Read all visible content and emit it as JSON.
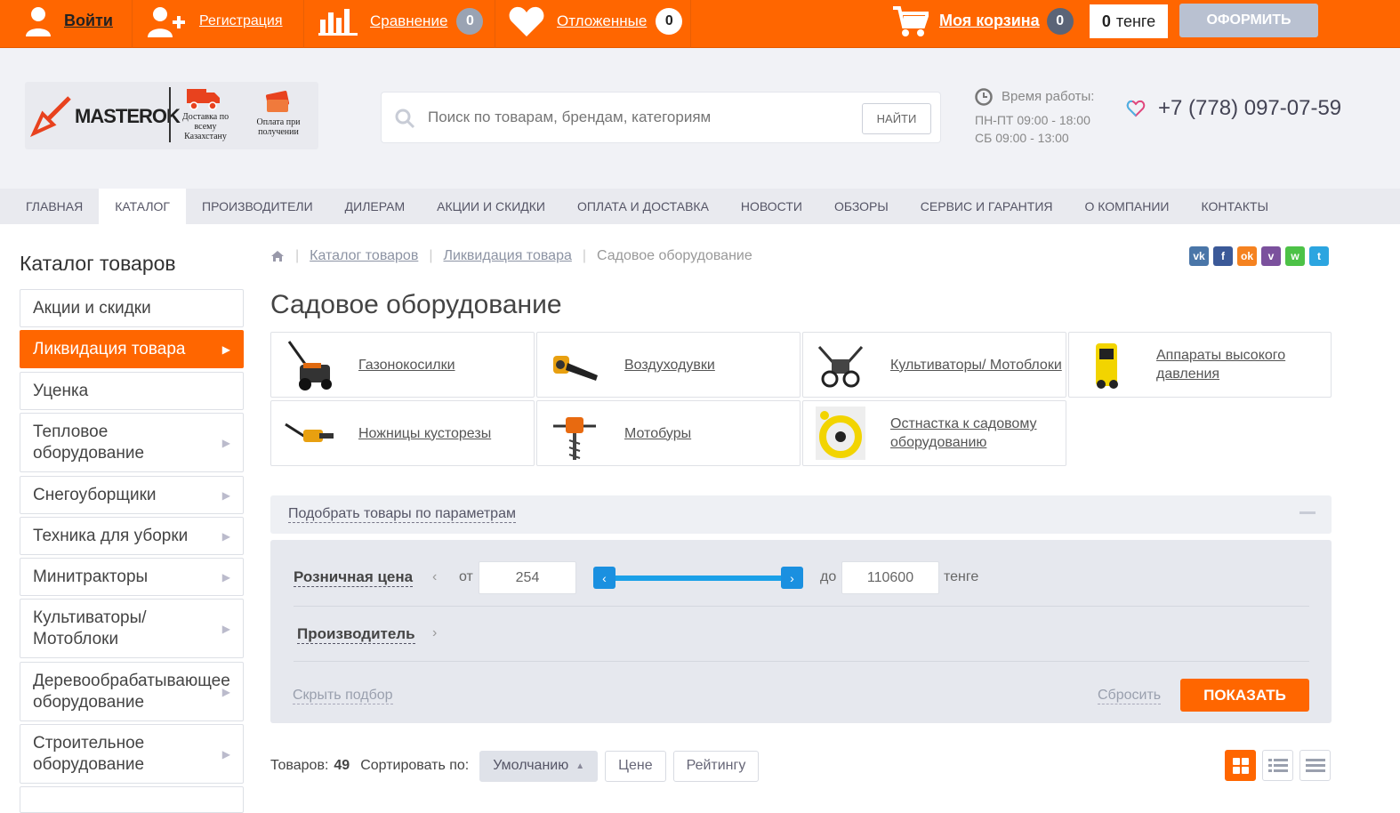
{
  "topbar": {
    "login": "Войти",
    "register": "Регистрация",
    "compare": "Сравнение",
    "compare_count": "0",
    "wishlist": "Отложенные",
    "wishlist_count": "0",
    "cart": "Моя корзина",
    "cart_count": "0",
    "sum_value": "0",
    "sum_currency": "тенге",
    "checkout": "ОФОРМИТЬ"
  },
  "header": {
    "logo_text": "MASTEROK",
    "logo_delivery": "Доставка по всему Казахстану",
    "logo_payment": "Оплата при получении",
    "search_placeholder": "Поиск по товарам, брендам, категориям",
    "search_button": "НАЙТИ",
    "worktime_title": "Время работы:",
    "worktime_weekdays": "ПН-ПТ 09:00 - 18:00",
    "worktime_saturday": "СБ 09:00 - 13:00",
    "phone": "+7 (778) 097-07-59"
  },
  "nav": [
    {
      "label": "ГЛАВНАЯ"
    },
    {
      "label": "КАТАЛОГ"
    },
    {
      "label": "ПРОИЗВОДИТЕЛИ"
    },
    {
      "label": "ДИЛЕРАМ"
    },
    {
      "label": "АКЦИИ И СКИДКИ"
    },
    {
      "label": "ОПЛАТА И ДОСТАВКА"
    },
    {
      "label": "НОВОСТИ"
    },
    {
      "label": "ОБЗОРЫ"
    },
    {
      "label": "СЕРВИС И ГАРАНТИЯ"
    },
    {
      "label": "О КОМПАНИИ"
    },
    {
      "label": "КОНТАКТЫ"
    }
  ],
  "sidebar": {
    "title": "Каталог товаров",
    "items": [
      {
        "label": "Акции и скидки"
      },
      {
        "label": "Ликвидация товара"
      },
      {
        "label": "Уценка"
      },
      {
        "label": "Тепловое оборудование"
      },
      {
        "label": "Снегоуборщики"
      },
      {
        "label": "Техника для уборки"
      },
      {
        "label": "Минитракторы"
      },
      {
        "label": "Культиваторы/ Мотоблоки"
      },
      {
        "label": "Деревообрабатывающее оборудование"
      },
      {
        "label": "Строительное оборудование"
      }
    ]
  },
  "breadcrumbs": {
    "catalog": "Каталог товаров",
    "liquidation": "Ликвидация товара",
    "current": "Садовое оборудование"
  },
  "share": {
    "vk": "vk",
    "fb": "f",
    "ok": "ok",
    "viber": "v",
    "whatsapp": "w",
    "telegram": "t"
  },
  "page_title": "Садовое оборудование",
  "categories": [
    {
      "label": "Газонокосилки",
      "icon": "lawnmower-icon"
    },
    {
      "label": "Воздуходувки",
      "icon": "blower-icon"
    },
    {
      "label": "Культиваторы/ Мотоблоки",
      "icon": "cultivator-icon"
    },
    {
      "label": "Аппараты высокого давления",
      "icon": "pressure-washer-icon"
    },
    {
      "label": "Ножницы кусторезы",
      "icon": "hedge-trimmer-icon"
    },
    {
      "label": "Мотобуры",
      "icon": "auger-icon"
    },
    {
      "label": "Остнастка к садовому оборудованию",
      "icon": "trimmer-line-icon"
    }
  ],
  "filter": {
    "head_label": "Подобрать товары по параметрам",
    "price_label": "Розничная цена",
    "from_label": "от",
    "from_value": "254",
    "to_label": "до",
    "to_value": "110600",
    "currency": "тенге",
    "manufacturer_label": "Производитель",
    "hide_label": "Скрыть подбор",
    "reset_label": "Сбросить",
    "show_label": "ПОКАЗАТЬ"
  },
  "sort": {
    "count_label": "Товаров:",
    "count_value": "49",
    "sort_label": "Сортировать по:",
    "default": "Умолчанию",
    "price": "Цене",
    "rating": "Рейтингу"
  },
  "colors": {
    "accent": "#ff6600",
    "slider": "#1aa0e8"
  }
}
